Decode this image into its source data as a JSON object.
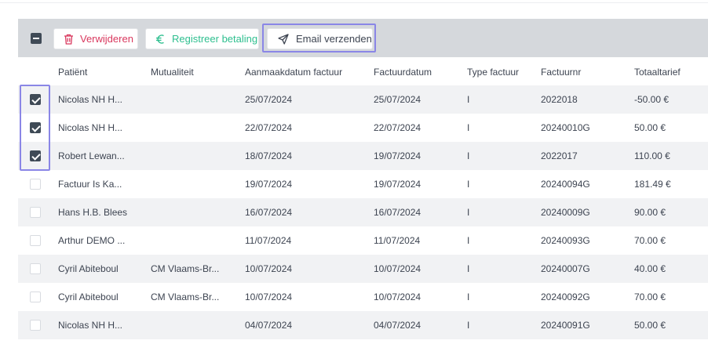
{
  "toolbar": {
    "delete_label": "Verwijderen",
    "register_payment_label": "Registreer betaling",
    "email_label": "Email verzenden",
    "icons": {
      "delete": "trash-icon",
      "payment": "euro-icon",
      "email": "send-icon"
    },
    "colors": {
      "delete": "#d9385e",
      "payment": "#2ebf8f",
      "highlight": "#8a86e6"
    }
  },
  "columns": [
    "Patiënt",
    "Mutualiteit",
    "Aanmaakdatum factuur",
    "Factuurdatum",
    "Type factuur",
    "Factuurnr",
    "Totaaltarief"
  ],
  "rows": [
    {
      "checked": true,
      "patient": "Nicolas NH H...",
      "mutualiteit": "",
      "aanmaakdatum": "25/07/2024",
      "factuurdatum": "25/07/2024",
      "type": "I",
      "nr": "2022018",
      "totaal": "-50.00 €"
    },
    {
      "checked": true,
      "patient": "Nicolas NH H...",
      "mutualiteit": "",
      "aanmaakdatum": "22/07/2024",
      "factuurdatum": "22/07/2024",
      "type": "I",
      "nr": "20240010G",
      "totaal": "50.00 €"
    },
    {
      "checked": true,
      "patient": "Robert Lewan...",
      "mutualiteit": "",
      "aanmaakdatum": "18/07/2024",
      "factuurdatum": "19/07/2024",
      "type": "I",
      "nr": "2022017",
      "totaal": "110.00 €"
    },
    {
      "checked": false,
      "patient": "Factuur Is Ka...",
      "mutualiteit": "",
      "aanmaakdatum": "19/07/2024",
      "factuurdatum": "19/07/2024",
      "type": "I",
      "nr": "20240094G",
      "totaal": "181.49 €"
    },
    {
      "checked": false,
      "patient": "Hans H.B. Blees",
      "mutualiteit": "",
      "aanmaakdatum": "16/07/2024",
      "factuurdatum": "16/07/2024",
      "type": "I",
      "nr": "20240009G",
      "totaal": "90.00 €"
    },
    {
      "checked": false,
      "patient": "Arthur DEMO ...",
      "mutualiteit": "",
      "aanmaakdatum": "11/07/2024",
      "factuurdatum": "11/07/2024",
      "type": "I",
      "nr": "20240093G",
      "totaal": "70.00 €"
    },
    {
      "checked": false,
      "patient": "Cyril Abiteboul",
      "mutualiteit": "CM Vlaams-Br...",
      "aanmaakdatum": "10/07/2024",
      "factuurdatum": "10/07/2024",
      "type": "I",
      "nr": "20240007G",
      "totaal": "40.00 €"
    },
    {
      "checked": false,
      "patient": "Cyril Abiteboul",
      "mutualiteit": "CM Vlaams-Br...",
      "aanmaakdatum": "10/07/2024",
      "factuurdatum": "10/07/2024",
      "type": "I",
      "nr": "20240092G",
      "totaal": "70.00 €"
    },
    {
      "checked": false,
      "patient": "Nicolas NH H...",
      "mutualiteit": "",
      "aanmaakdatum": "04/07/2024",
      "factuurdatum": "04/07/2024",
      "type": "I",
      "nr": "20240091G",
      "totaal": "50.00 €"
    }
  ]
}
